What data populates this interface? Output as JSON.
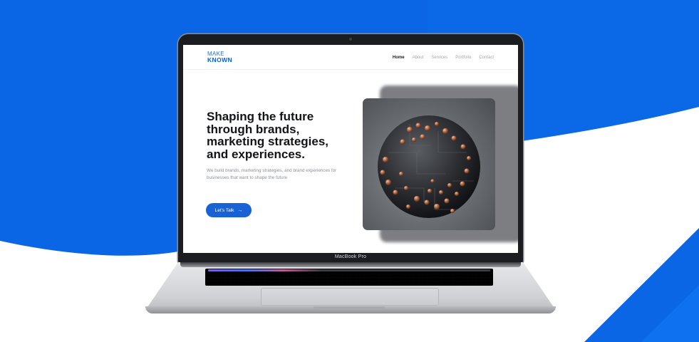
{
  "laptop": {
    "model_label": "MacBook Pro"
  },
  "site": {
    "logo": {
      "line1": "MAKE",
      "line2": "KNOWN"
    },
    "nav": [
      {
        "label": "Home",
        "active": true
      },
      {
        "label": "About",
        "active": false
      },
      {
        "label": "Services",
        "active": false
      },
      {
        "label": "Portfolio",
        "active": false
      },
      {
        "label": "Contact",
        "active": false
      }
    ],
    "hero": {
      "title": "Shaping the future through brands, marketing strategies, and experiences.",
      "subtitle": "We build brands, marketing strategies, and brand experiences for businesses that want to shape the future",
      "cta_label": "Let's Talk",
      "cta_icon": "arrow-right-icon"
    }
  },
  "colors": {
    "background_blue": "#0a66e4",
    "accent_blue": "#1763d6",
    "text_dark": "#131417"
  }
}
